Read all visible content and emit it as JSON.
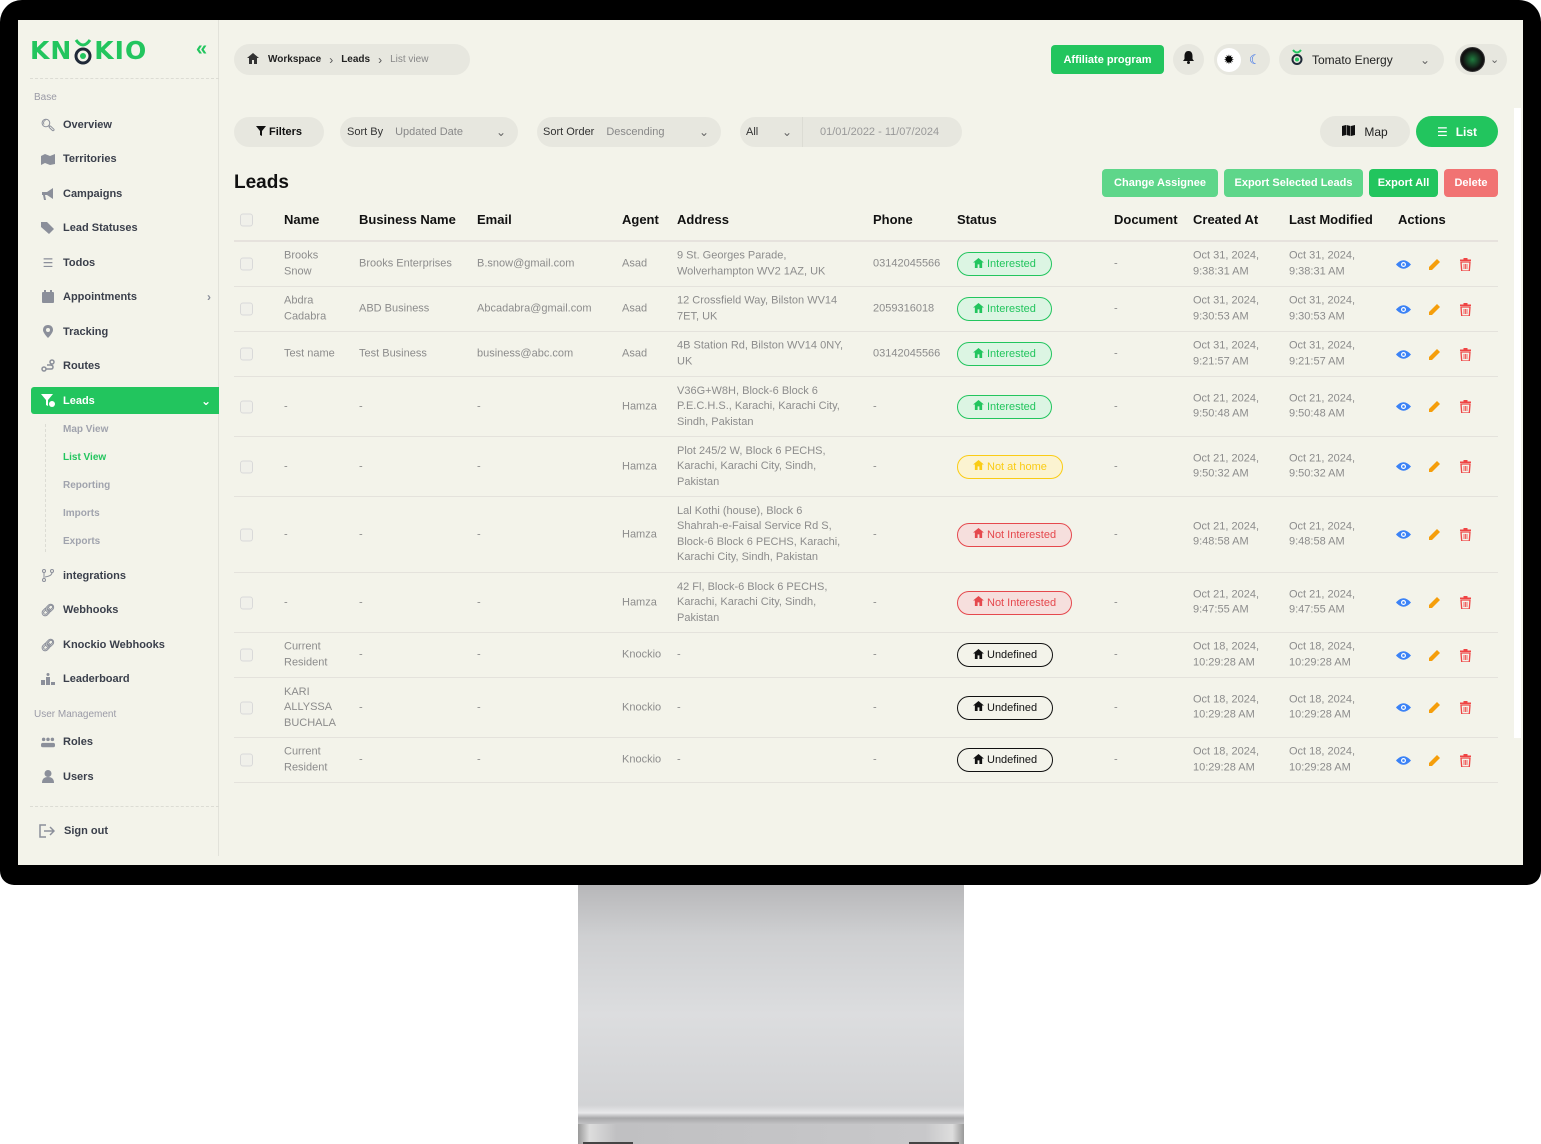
{
  "app": {
    "brand": "KNOCKIO"
  },
  "sidebar": {
    "section_base": "Base",
    "section_user_mgmt": "User Management",
    "items": [
      {
        "label": "Overview",
        "icon": "chart-search-icon"
      },
      {
        "label": "Territories",
        "icon": "map-icon"
      },
      {
        "label": "Campaigns",
        "icon": "megaphone-icon"
      },
      {
        "label": "Lead Statuses",
        "icon": "tags-icon"
      },
      {
        "label": "Todos",
        "icon": "list-icon"
      },
      {
        "label": "Appointments",
        "icon": "calendar-icon"
      },
      {
        "label": "Tracking",
        "icon": "location-pin-icon"
      },
      {
        "label": "Routes",
        "icon": "route-icon"
      },
      {
        "label": "Leads",
        "icon": "funnel-icon"
      },
      {
        "label": "integrations",
        "icon": "branch-icon"
      },
      {
        "label": "Webhooks",
        "icon": "link-icon"
      },
      {
        "label": "Knockio Webhooks",
        "icon": "link-icon"
      },
      {
        "label": "Leaderboard",
        "icon": "podium-icon"
      }
    ],
    "leads_sub": [
      "Map View",
      "List View",
      "Reporting",
      "Imports",
      "Exports"
    ],
    "user_items": [
      {
        "label": "Roles",
        "icon": "users-group-icon"
      },
      {
        "label": "Users",
        "icon": "user-icon"
      }
    ],
    "sign_out": "Sign out"
  },
  "header": {
    "breadcrumb": [
      "Workspace",
      "Leads",
      "List view"
    ],
    "affiliate": "Affiliate program",
    "org": "Tomato Energy"
  },
  "toolbar": {
    "filters": "Filters",
    "sort_by_label": "Sort By",
    "sort_by_value": "Updated Date",
    "sort_order_label": "Sort Order",
    "sort_order_value": "Descending",
    "range_type": "All",
    "date_range": "01/01/2022 - 11/07/2024",
    "map": "Map",
    "list": "List"
  },
  "page": {
    "title": "Leads",
    "actions": {
      "change_assignee": "Change Assignee",
      "export_selected": "Export Selected Leads",
      "export_all": "Export All",
      "delete": "Delete"
    }
  },
  "colors": {
    "accent": "#22c55e",
    "interested": "#22c55e",
    "not_at_home": "#facc15",
    "not_interested": "#ef4444",
    "undefined": "#111111",
    "view": "#3b82f6",
    "edit": "#f59e0b",
    "delete": "#ef4444"
  },
  "table": {
    "columns": [
      "Name",
      "Business Name",
      "Email",
      "Agent",
      "Address",
      "Phone",
      "Status",
      "Document",
      "Created At",
      "Last Modified",
      "Actions"
    ],
    "rows": [
      {
        "name": "Brooks\nSnow",
        "business": "Brooks Enterprises",
        "email": "B.snow@gmail.com",
        "agent": "Asad",
        "address": "9 St. Georges Parade,\nWolverhampton WV2 1AZ, UK",
        "phone": "03142045566",
        "status": "Interested",
        "status_type": "interested",
        "document": "-",
        "created": "Oct 31, 2024,\n9:38:31 AM",
        "modified": "Oct 31, 2024,\n9:38:31 AM"
      },
      {
        "name": "Abdra\nCadabra",
        "business": "ABD Business",
        "email": "Abcadabra@gmail.com",
        "agent": "Asad",
        "address": "12 Crossfield Way, Bilston WV14\n7ET, UK",
        "phone": "2059316018",
        "status": "Interested",
        "status_type": "interested",
        "document": "-",
        "created": "Oct 31, 2024,\n9:30:53 AM",
        "modified": "Oct 31, 2024,\n9:30:53 AM"
      },
      {
        "name": "Test name",
        "business": "Test Business",
        "email": "business@abc.com",
        "agent": "Asad",
        "address": "4B Station Rd, Bilston WV14 0NY,\nUK",
        "phone": "03142045566",
        "status": "Interested",
        "status_type": "interested",
        "document": "-",
        "created": "Oct 31, 2024,\n9:21:57 AM",
        "modified": "Oct 31, 2024,\n9:21:57 AM"
      },
      {
        "name": "-",
        "business": "-",
        "email": "-",
        "agent": "Hamza",
        "address": "V36G+W8H, Block-6 Block 6\nP.E.C.H.S., Karachi, Karachi City,\nSindh, Pakistan",
        "phone": "-",
        "status": "Interested",
        "status_type": "interested",
        "document": "-",
        "created": "Oct 21, 2024,\n9:50:48 AM",
        "modified": "Oct 21, 2024,\n9:50:48 AM"
      },
      {
        "name": "-",
        "business": "-",
        "email": "-",
        "agent": "Hamza",
        "address": "Plot 245/2 W, Block 6 PECHS,\nKarachi, Karachi City, Sindh,\nPakistan",
        "phone": "-",
        "status": "Not at home",
        "status_type": "not_at_home",
        "document": "-",
        "created": "Oct 21, 2024,\n9:50:32 AM",
        "modified": "Oct 21, 2024,\n9:50:32 AM"
      },
      {
        "name": "-",
        "business": "-",
        "email": "-",
        "agent": "Hamza",
        "address": "Lal Kothi (house), Block 6\nShahrah-e-Faisal Service Rd S,\nBlock-6 Block 6 PECHS, Karachi,\nKarachi City, Sindh, Pakistan",
        "phone": "-",
        "status": "Not Interested",
        "status_type": "not_interested",
        "document": "-",
        "created": "Oct 21, 2024,\n9:48:58 AM",
        "modified": "Oct 21, 2024,\n9:48:58 AM"
      },
      {
        "name": "-",
        "business": "-",
        "email": "-",
        "agent": "Hamza",
        "address": "42 Fl, Block-6 Block 6 PECHS,\nKarachi, Karachi City, Sindh,\nPakistan",
        "phone": "-",
        "status": "Not Interested",
        "status_type": "not_interested",
        "document": "-",
        "created": "Oct 21, 2024,\n9:47:55 AM",
        "modified": "Oct 21, 2024,\n9:47:55 AM"
      },
      {
        "name": "Current\nResident",
        "business": "-",
        "email": "-",
        "agent": "Knockio",
        "address": "-",
        "phone": "-",
        "status": "Undefined",
        "status_type": "undefined",
        "document": "-",
        "created": "Oct 18, 2024,\n10:29:28 AM",
        "modified": "Oct 18, 2024,\n10:29:28 AM"
      },
      {
        "name": "KARI\nALLYSSA\nBUCHALA",
        "business": "-",
        "email": "-",
        "agent": "Knockio",
        "address": "-",
        "phone": "-",
        "status": "Undefined",
        "status_type": "undefined",
        "document": "-",
        "created": "Oct 18, 2024,\n10:29:28 AM",
        "modified": "Oct 18, 2024,\n10:29:28 AM"
      },
      {
        "name": "Current\nResident",
        "business": "-",
        "email": "-",
        "agent": "Knockio",
        "address": "-",
        "phone": "-",
        "status": "Undefined",
        "status_type": "undefined",
        "document": "-",
        "created": "Oct 18, 2024,\n10:29:28 AM",
        "modified": "Oct 18, 2024,\n10:29:28 AM"
      }
    ]
  }
}
